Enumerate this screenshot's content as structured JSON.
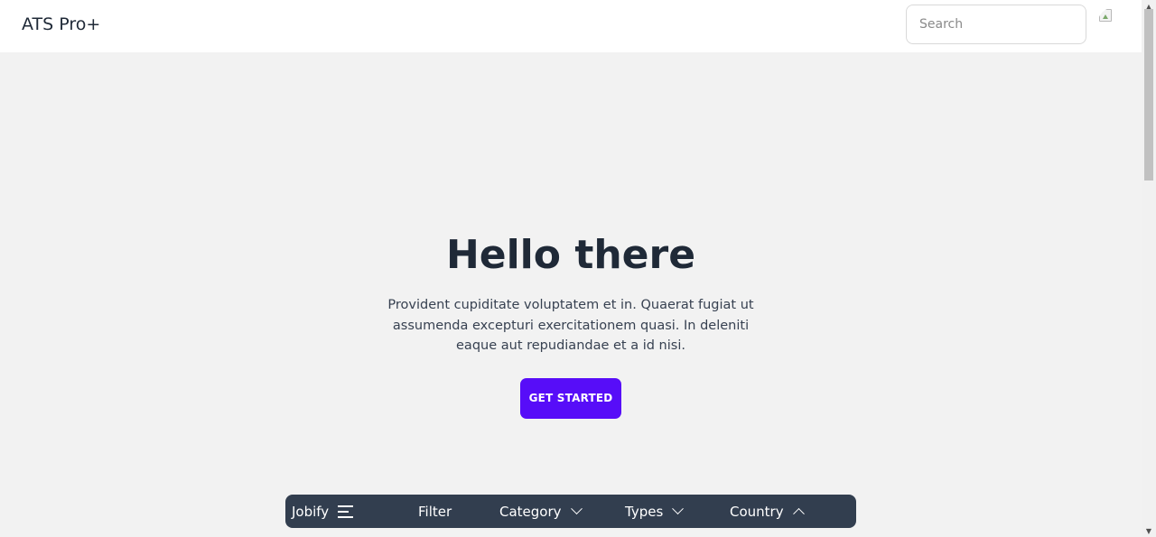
{
  "navbar": {
    "brand": "ATS Pro+",
    "search_placeholder": "Search",
    "avatar_icon": "broken-image-icon"
  },
  "hero": {
    "title": "Hello there",
    "description": "Provident cupiditate voluptatem et in. Quaerat fugiat ut assumenda excepturi exercitationem quasi. In deleniti eaque aut repudiandae et a id nisi.",
    "cta_label": "GET STARTED"
  },
  "bottom_bar": {
    "brand": "Jobify",
    "brand_icon": "menu-icon",
    "filter_label": "Filter",
    "category_label": "Category",
    "category_icon": "chevron-down-icon",
    "types_label": "Types",
    "types_icon": "chevron-down-icon",
    "country_label": "Country",
    "country_icon": "chevron-up-icon"
  },
  "colors": {
    "primary": "#570df8",
    "bottom_bar_bg": "#323e4f",
    "page_bg": "#f2f2f2"
  }
}
